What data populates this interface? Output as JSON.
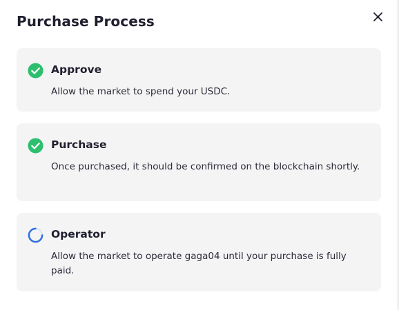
{
  "modal": {
    "title": "Purchase Process",
    "close_icon": "close-icon"
  },
  "steps": [
    {
      "title": "Approve",
      "description": "Allow the market to spend your USDC.",
      "status": "complete",
      "icon": "check-circle-icon"
    },
    {
      "title": "Purchase",
      "description": "Once purchased, it should be confirmed on the blockchain shortly.",
      "status": "complete",
      "icon": "check-circle-icon"
    },
    {
      "title": "Operator",
      "description": "Allow the market to operate gaga04 until your purchase is fully paid.",
      "status": "in-progress",
      "icon": "spinner-icon"
    }
  ],
  "colors": {
    "success": "#2dbf6e",
    "spinner": "#2f6fe0",
    "card_bg": "#f4f4f5",
    "text": "#1f1f2e"
  }
}
